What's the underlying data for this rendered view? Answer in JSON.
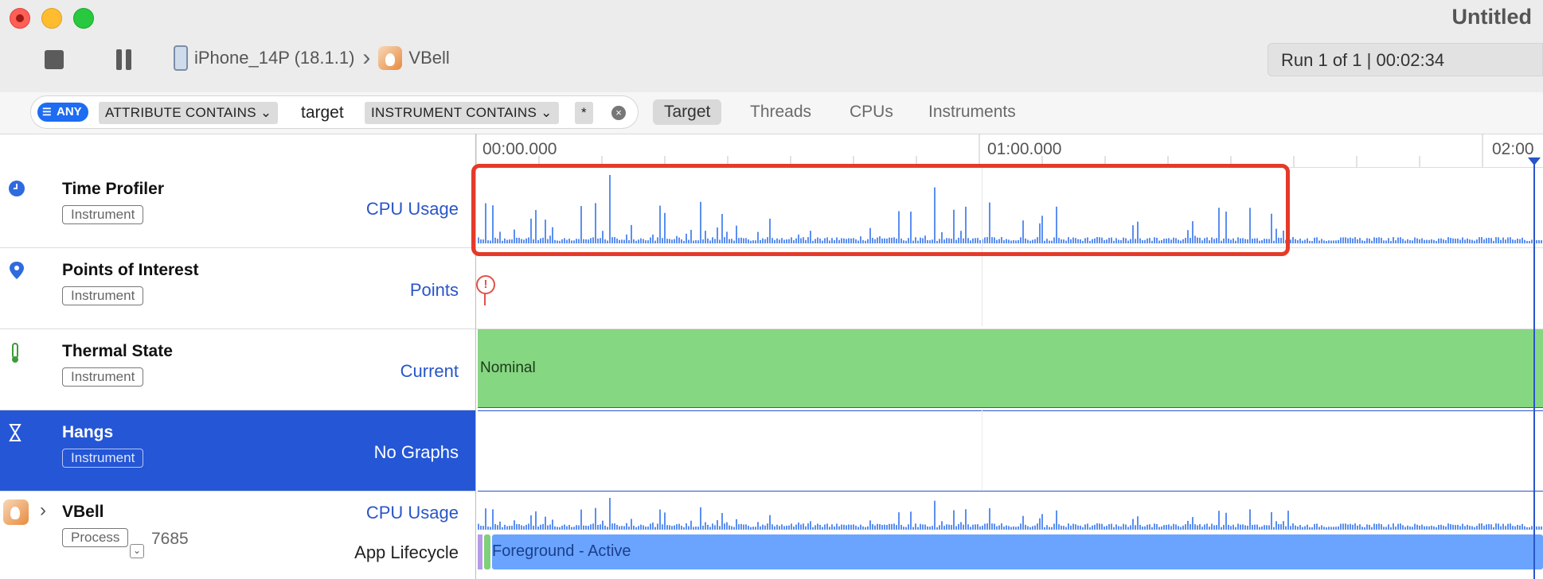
{
  "window": {
    "title": "Untitled"
  },
  "toolbar": {
    "device": "iPhone_14P (18.1.1)",
    "app": "VBell",
    "run_status": "Run 1 of 1  |  00:02:34"
  },
  "filter": {
    "any_label": "ANY",
    "token1": "ATTRIBUTE CONTAINS",
    "value1": "target",
    "token2": "INSTRUMENT CONTAINS",
    "value2": "*"
  },
  "segments": [
    "Target",
    "Threads",
    "CPUs",
    "Instruments"
  ],
  "ruler": {
    "t0": "00:00.000",
    "t1": "01:00.000",
    "t2": "02:00"
  },
  "rows": [
    {
      "name": "Time Profiler",
      "badge": "Instrument",
      "graph": "CPU Usage",
      "icon": "clock-icon"
    },
    {
      "name": "Points of Interest",
      "badge": "Instrument",
      "graph": "Points",
      "icon": "pin-icon"
    },
    {
      "name": "Thermal State",
      "badge": "Instrument",
      "graph": "Current",
      "icon": "thermometer-icon"
    },
    {
      "name": "Hangs",
      "badge": "Instrument",
      "graph": "No Graphs",
      "icon": "hourglass-icon"
    }
  ],
  "process": {
    "name": "VBell",
    "badge": "Process",
    "pid": "7685",
    "graph1": "CPU Usage",
    "graph2": "App Lifecycle"
  },
  "thermal_value": "Nominal",
  "poi_marker": "!",
  "lifecycle_label": "Foreground - Active",
  "colors": {
    "accent": "#2456d6",
    "cpu_bars": "#5b8ff0",
    "thermal": "#86d782",
    "lifecycle": "#6aa4ff",
    "highlight_box": "#e53a2a"
  }
}
